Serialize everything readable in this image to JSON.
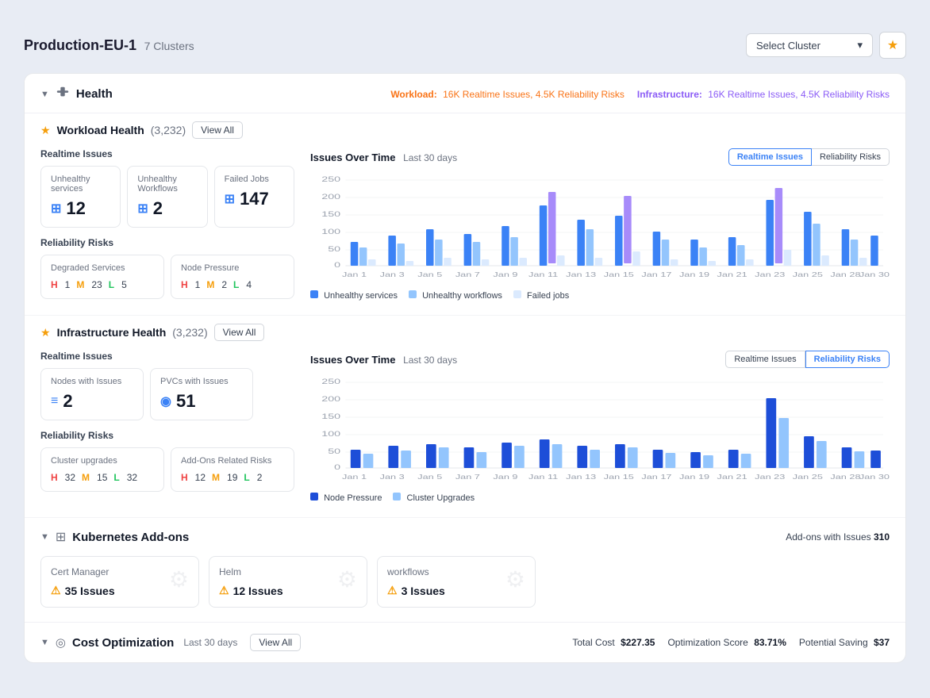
{
  "page": {
    "title": "Production-EU-1",
    "cluster_count": "7 Clusters"
  },
  "header": {
    "select_cluster_placeholder": "Select Cluster",
    "star_label": "★"
  },
  "health_section": {
    "title": "Health",
    "collapse_icon": "▼",
    "workload_badge": "Workload:",
    "workload_detail": "16K Realtime Issues, 4.5K Reliability Risks",
    "infra_badge": "Infrastructure:",
    "infra_detail": "16K Realtime Issues, 4.5K Reliability Risks"
  },
  "workload_health": {
    "title": "Workload Health",
    "count": "(3,232)",
    "view_all": "View All",
    "realtime_label": "Realtime Issues",
    "unhealthy_services_label": "Unhealthy services",
    "unhealthy_services_value": "12",
    "unhealthy_workflows_label": "Unhealthy Workflows",
    "unhealthy_workflows_value": "2",
    "failed_jobs_label": "Failed Jobs",
    "failed_jobs_value": "147",
    "reliability_label": "Reliability Risks",
    "degraded_label": "Degraded Services",
    "degraded_h": "1",
    "degraded_m": "23",
    "degraded_l": "5",
    "node_pressure_label": "Node Pressure",
    "node_h": "1",
    "node_m": "2",
    "node_l": "4",
    "chart_title": "Issues Over Time",
    "chart_period": "Last 30 days",
    "tab_realtime": "Realtime Issues",
    "tab_reliability": "Reliability Risks",
    "legend_unhealthy_svc": "Unhealthy services",
    "legend_unhealthy_wf": "Unhealthy workflows",
    "legend_failed": "Failed jobs",
    "chart_y_labels": [
      "250",
      "200",
      "150",
      "100",
      "50",
      "0"
    ],
    "chart_x_labels": [
      "Jan 1",
      "Jan 3",
      "Jan 5",
      "Jan 7",
      "Jan 9",
      "Jan 11",
      "Jan 13",
      "Jan 15",
      "Jan 17",
      "Jan 19",
      "Jan 21",
      "Jan 23",
      "Jan 25",
      "Jan 28",
      "Jan 30"
    ]
  },
  "infra_health": {
    "title": "Infrastructure Health",
    "count": "(3,232)",
    "view_all": "View All",
    "realtime_label": "Realtime Issues",
    "nodes_label": "Nodes with Issues",
    "nodes_value": "2",
    "pvcs_label": "PVCs with Issues",
    "pvcs_value": "51",
    "reliability_label": "Reliability Risks",
    "cluster_upgrades_label": "Cluster upgrades",
    "cluster_h": "32",
    "cluster_m": "15",
    "cluster_l": "32",
    "addons_label": "Add-Ons Related Risks",
    "addons_h": "12",
    "addons_m": "19",
    "addons_l": "2",
    "chart_title": "Issues Over Time",
    "chart_period": "Last 30 days",
    "tab_realtime": "Realtime Issues",
    "tab_reliability": "Reliability Risks",
    "legend_node": "Node Pressure",
    "legend_cluster": "Cluster Upgrades",
    "chart_y_labels": [
      "250",
      "200",
      "150",
      "100",
      "50",
      "0"
    ],
    "chart_x_labels": [
      "Jan 1",
      "Jan 3",
      "Jan 5",
      "Jan 7",
      "Jan 9",
      "Jan 11",
      "Jan 13",
      "Jan 15",
      "Jan 17",
      "Jan 19",
      "Jan 21",
      "Jan 23",
      "Jan 25",
      "Jan 28",
      "Jan 30"
    ]
  },
  "kubernetes_addons": {
    "title": "Kubernetes Add-ons",
    "badge_label": "Add-ons with Issues",
    "badge_count": "310",
    "cert_manager": "Cert Manager",
    "cert_issues": "35 Issues",
    "helm": "Helm",
    "helm_issues": "12 Issues",
    "workflows": "workflows",
    "workflows_issues": "3 Issues"
  },
  "cost_optimization": {
    "title": "Cost Optimization",
    "period": "Last 30 days",
    "view_all": "View All",
    "total_cost_label": "Total Cost",
    "total_cost": "$227.35",
    "opt_score_label": "Optimization Score",
    "opt_score": "83.71%",
    "potential_label": "Potential Saving",
    "potential": "$37"
  }
}
